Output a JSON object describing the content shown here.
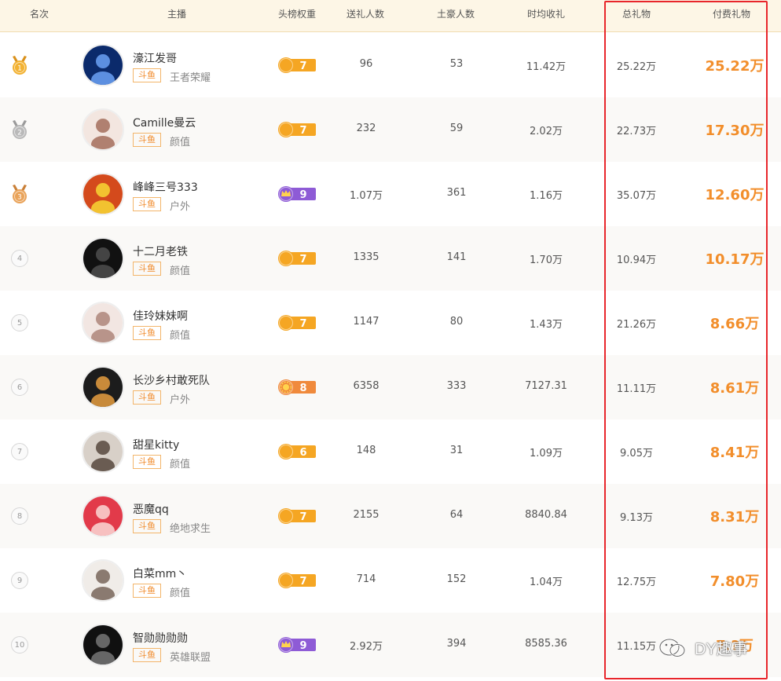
{
  "headers": {
    "rank": "名次",
    "host": "主播",
    "weight": "头榜权重",
    "gifters": "送礼人数",
    "tuhao": "土豪人数",
    "hourly": "时均收礼",
    "total": "总礼物",
    "paid": "付费礼物"
  },
  "rows": [
    {
      "rank": "1",
      "name": "濠江发哥",
      "platform": "斗鱼",
      "category": "王者荣耀",
      "level": "7",
      "level_type": "moon",
      "gifters": "96",
      "tuhao": "53",
      "hourly": "11.42万",
      "total": "25.22万",
      "paid": "25.22万"
    },
    {
      "rank": "2",
      "name": "Camille曼云",
      "platform": "斗鱼",
      "category": "颜值",
      "level": "7",
      "level_type": "moon",
      "gifters": "232",
      "tuhao": "59",
      "hourly": "2.02万",
      "total": "22.73万",
      "paid": "17.30万"
    },
    {
      "rank": "3",
      "name": "峰峰三号333",
      "platform": "斗鱼",
      "category": "户外",
      "level": "9",
      "level_type": "crown",
      "gifters": "1.07万",
      "tuhao": "361",
      "hourly": "1.16万",
      "total": "35.07万",
      "paid": "12.60万"
    },
    {
      "rank": "4",
      "name": "十二月老铁",
      "platform": "斗鱼",
      "category": "颜值",
      "level": "7",
      "level_type": "moon",
      "gifters": "1335",
      "tuhao": "141",
      "hourly": "1.70万",
      "total": "10.94万",
      "paid": "10.17万"
    },
    {
      "rank": "5",
      "name": "佳玲妹妹啊",
      "platform": "斗鱼",
      "category": "颜值",
      "level": "7",
      "level_type": "moon",
      "gifters": "1147",
      "tuhao": "80",
      "hourly": "1.43万",
      "total": "21.26万",
      "paid": "8.66万"
    },
    {
      "rank": "6",
      "name": "长沙乡村敢死队",
      "platform": "斗鱼",
      "category": "户外",
      "level": "8",
      "level_type": "sun",
      "gifters": "6358",
      "tuhao": "333",
      "hourly": "7127.31",
      "total": "11.11万",
      "paid": "8.61万"
    },
    {
      "rank": "7",
      "name": "甜星kitty",
      "platform": "斗鱼",
      "category": "颜值",
      "level": "6",
      "level_type": "moon",
      "gifters": "148",
      "tuhao": "31",
      "hourly": "1.09万",
      "total": "9.05万",
      "paid": "8.41万"
    },
    {
      "rank": "8",
      "name": "恶魔qq",
      "platform": "斗鱼",
      "category": "绝地求生",
      "level": "7",
      "level_type": "moon",
      "gifters": "2155",
      "tuhao": "64",
      "hourly": "8840.84",
      "total": "9.13万",
      "paid": "8.31万"
    },
    {
      "rank": "9",
      "name": "白菜mm丶",
      "platform": "斗鱼",
      "category": "颜值",
      "level": "7",
      "level_type": "moon",
      "gifters": "714",
      "tuhao": "152",
      "hourly": "1.04万",
      "total": "12.75万",
      "paid": "7.80万"
    },
    {
      "rank": "10",
      "name": "智勋勋勋勋",
      "platform": "斗鱼",
      "category": "英雄联盟",
      "level": "9",
      "level_type": "crown",
      "gifters": "2.92万",
      "tuhao": "394",
      "hourly": "8585.36",
      "total": "11.15万",
      "paid": "7.?万"
    }
  ],
  "watermark": "DY趣事",
  "colors": {
    "accent": "#f28e2b",
    "highlight_border": "#e8262b",
    "header_bg": "#fdf6e6",
    "moon_badge": "#f5a623",
    "crown_badge": "#8e5bd6",
    "sun_badge": "#f08a3c"
  }
}
